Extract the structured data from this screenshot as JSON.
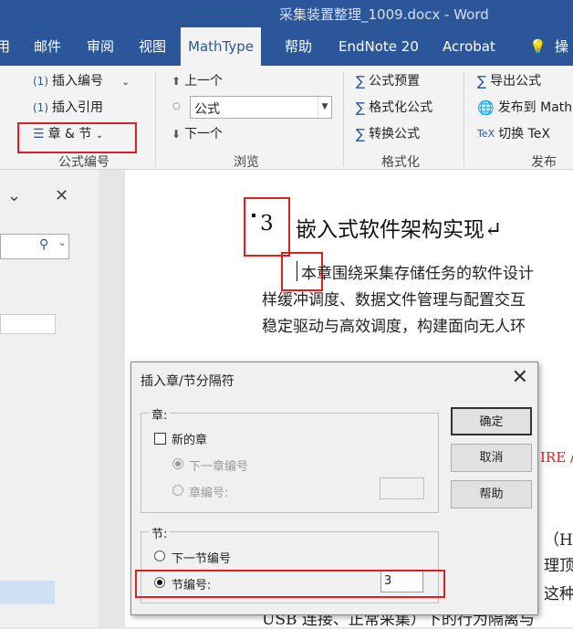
{
  "window": {
    "title": "采集装置整理_1009.docx - Word"
  },
  "tabs": [
    "用",
    "邮件",
    "审阅",
    "视图",
    "MathType",
    "帮助",
    "EndNote 20",
    "Acrobat",
    "操"
  ],
  "active_tab": "MathType",
  "ribbon": {
    "insert_number": "插入编号",
    "insert_ref": "插入引用",
    "chapter_section": "章 & 节",
    "group_equation_number": "公式编号",
    "prev": "上一个",
    "combo_value": "公式",
    "next": "下一个",
    "group_browse": "浏览",
    "equation_preset": "公式预置",
    "format_equation": "格式化公式",
    "convert_equation": "转换公式",
    "group_format": "格式化",
    "export_equation": "导出公式",
    "publish_to": "发布到 Math",
    "toggle_tex": "切换 TeX",
    "group_publish": "发布"
  },
  "document": {
    "chapter_number": "3",
    "heading": "嵌入式软件架构实现↵",
    "para_line1": "本章围绕采集存储任务的软件设计",
    "para_line2": "样缓冲调度、数据文件管理与配置交互",
    "para_line3": "稳定驱动与高效调度，构建面向无人环",
    "red_fragment": "IRE /",
    "right_frag1": "（Hi",
    "right_frag2": "理顶",
    "right_frag3": "这种",
    "bottom_line": "USB 连接、正常采集）下的行为隔离与"
  },
  "dialog": {
    "title": "插入章/节分隔符",
    "chapter_group": "章:",
    "new_chapter": "新的章",
    "next_chapter_number": "下一章编号",
    "chapter_number": "章编号:",
    "section_group": "节:",
    "next_section_number": "下一节编号",
    "section_number": "节编号:",
    "section_number_value": "3",
    "ok": "确定",
    "cancel": "取消",
    "help": "帮助"
  }
}
